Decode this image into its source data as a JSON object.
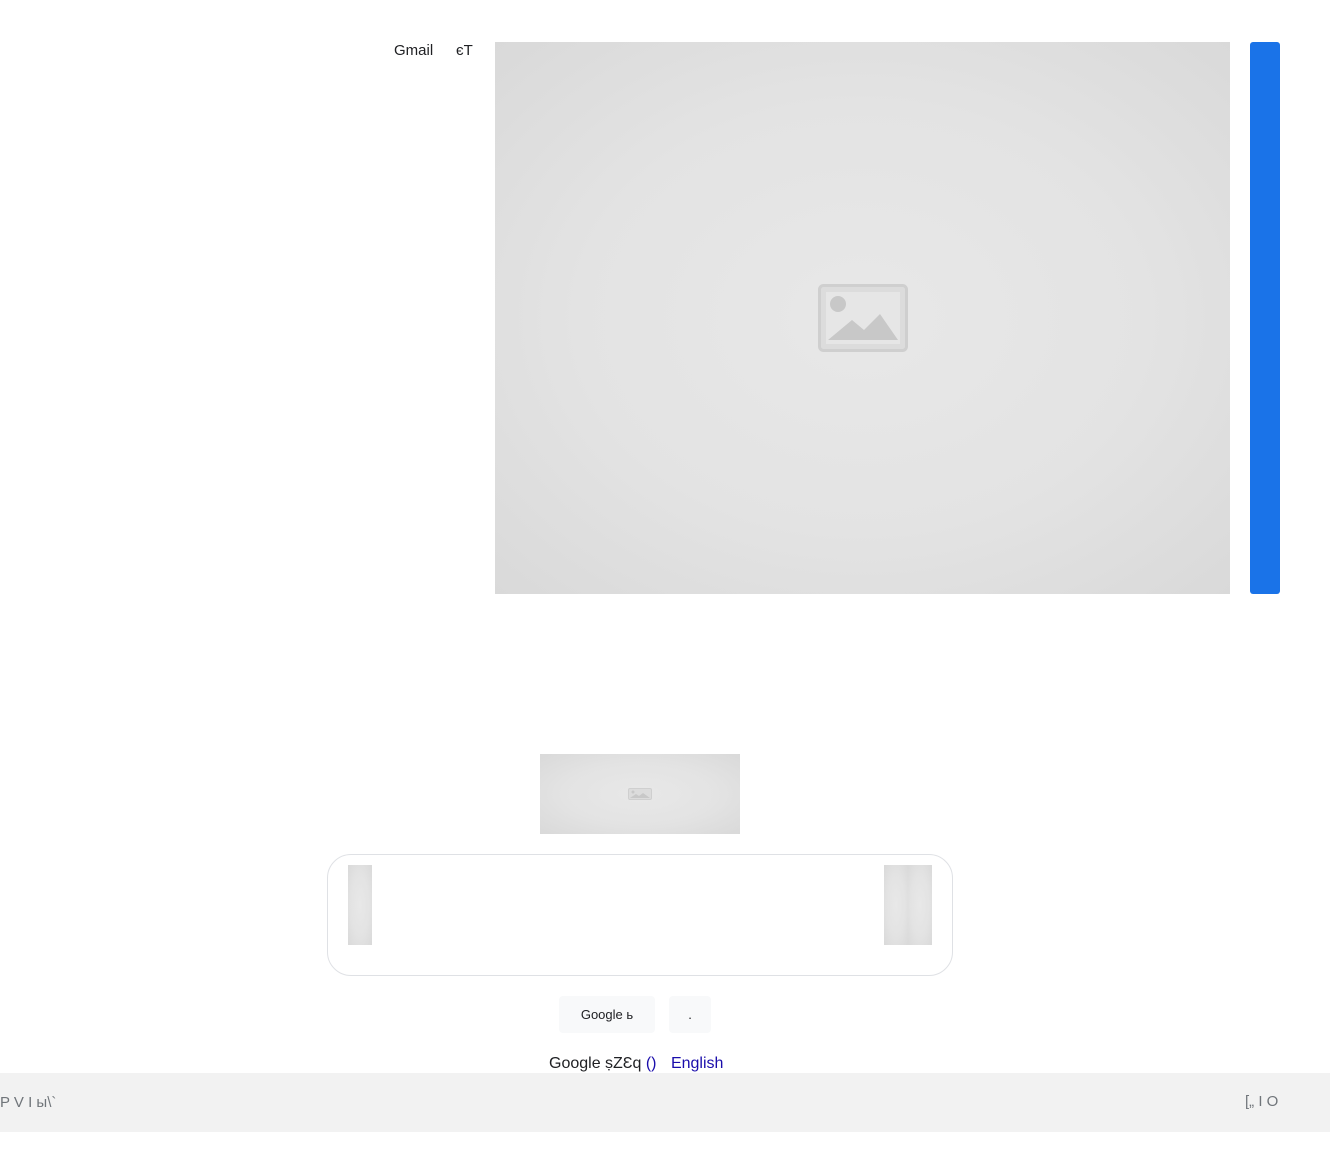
{
  "header": {
    "gmail_label": "Gmail",
    "images_label": "єТ"
  },
  "main": {
    "search_button_label": "Google ь",
    "lucky_button_label": ".",
    "offered_in_prefix": "Google ṣZƐq",
    "offered_in_paren": "()",
    "language_link": "English"
  },
  "footer": {
    "left_text": "P V I ы\\`",
    "right_text": "[„ I O"
  },
  "colors": {
    "signin_button": "#1a73e8",
    "link": "#1a0dab",
    "footer_bg": "#f2f2f2"
  },
  "icons": {
    "broken_image": "image-placeholder-icon"
  }
}
